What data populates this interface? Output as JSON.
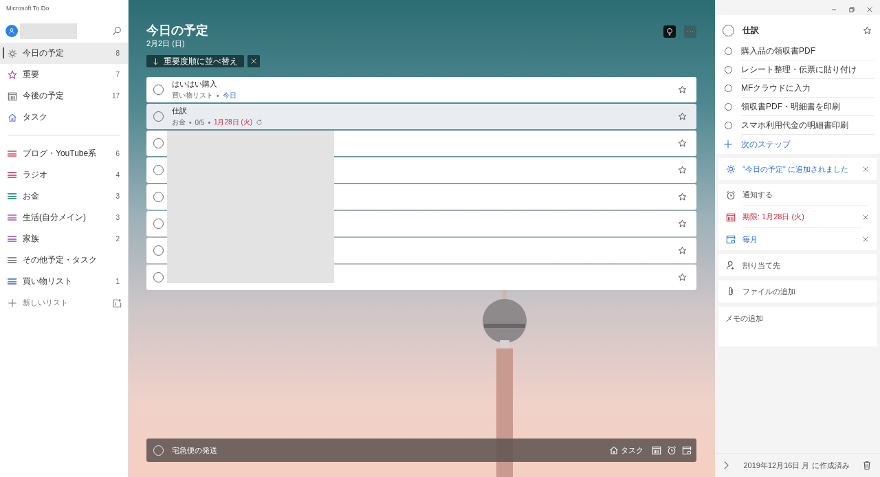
{
  "app_title": "Microsoft To Do",
  "sidebar": {
    "items": [
      {
        "label": "今日の予定",
        "count": "8",
        "kind": "sun",
        "selected": true
      },
      {
        "label": "重要",
        "count": "7",
        "kind": "star",
        "selected": false
      },
      {
        "label": "今後の予定",
        "count": "17",
        "kind": "calendar",
        "selected": false
      },
      {
        "label": "タスク",
        "kind": "home",
        "selected": false
      }
    ],
    "lists": [
      {
        "label": "ブログ・YouTube系",
        "count": "6",
        "color": "#e0707a",
        "selected": false
      },
      {
        "label": "ラジオ",
        "count": "4",
        "color": "#d0607a",
        "selected": false
      },
      {
        "label": "お金",
        "count": "3",
        "color": "#4a9a8a",
        "selected": false
      },
      {
        "label": "生活(自分メイン)",
        "count": "3",
        "color": "#c080c8",
        "selected": false
      },
      {
        "label": "家族",
        "count": "2",
        "color": "#a878c0",
        "selected": false
      },
      {
        "label": "その他予定・タスク",
        "color": "#8a8a8a",
        "selected": false
      },
      {
        "label": "買い物リスト",
        "count": "1",
        "color": "#6a8ad8",
        "selected": false
      }
    ],
    "new_list": "新しいリスト"
  },
  "main": {
    "meta_separator": "•",
    "title": "今日の予定",
    "date": "2月2日 (日)",
    "sort_label": "重要度順に並べ替え",
    "idea_on": true,
    "tasks": [
      {
        "title": "はいはい購入",
        "list": "買い物リスト",
        "due": "今日",
        "overdue": false,
        "selected": false,
        "done": false,
        "starred": false
      },
      {
        "title": "仕訳",
        "list": "お金",
        "steps": "0/5",
        "due": "1月28日 (火)",
        "overdue": true,
        "repeat": true,
        "selected": true,
        "done": false,
        "starred": false
      },
      {
        "selected": false,
        "done": false,
        "starred": false
      },
      {
        "selected": false,
        "done": false,
        "starred": false
      },
      {
        "selected": false,
        "done": false,
        "starred": false
      },
      {
        "selected": false,
        "done": false,
        "starred": false
      },
      {
        "selected": false,
        "done": false,
        "starred": false
      },
      {
        "selected": false,
        "done": false,
        "starred": false
      }
    ],
    "add_task": {
      "value": "宅急便の発送",
      "list": "タスク"
    }
  },
  "detail": {
    "title": "仕訳",
    "done": false,
    "starred": false,
    "steps": [
      {
        "label": "購入品の領収書PDF",
        "done": false
      },
      {
        "label": "レシート整理・伝票に貼り付け",
        "done": false
      },
      {
        "label": "MFクラウドに入力",
        "done": false
      },
      {
        "label": "領収書PDF・明細書を印刷",
        "done": false
      },
      {
        "label": "スマホ利用代金の明細書印刷",
        "done": false
      }
    ],
    "next_step": "次のステップ",
    "my_day": "\"今日の予定\" に追加されました",
    "reminder": "通知する",
    "due": "期限: 1月28日 (火)",
    "repeat": "毎月",
    "assign": "割り当て先",
    "file": "ファイルの追加",
    "note_placeholder": "メモの追加",
    "created": "2019年12月16日 月 に作成済み"
  }
}
